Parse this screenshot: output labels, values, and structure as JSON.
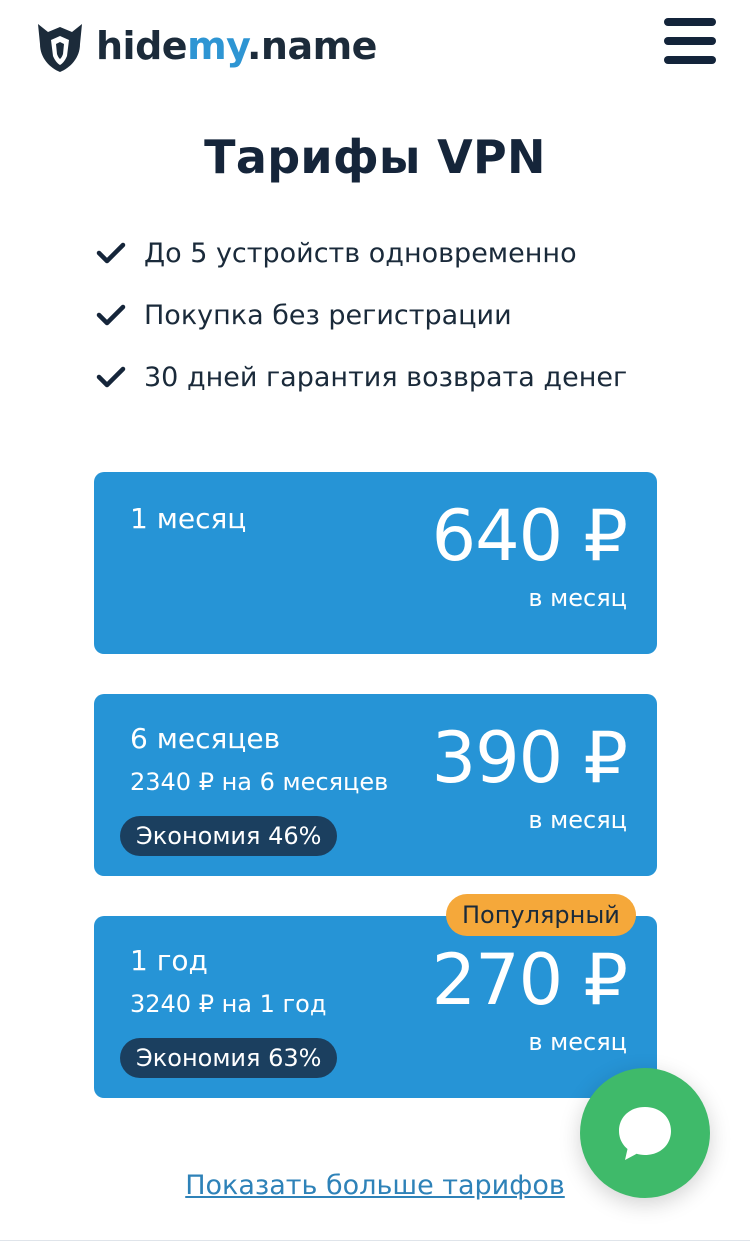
{
  "header": {
    "logo_part1": "hide",
    "logo_accent": "my",
    "logo_part2": ".name"
  },
  "page_title": "Тарифы VPN",
  "features": [
    "До 5 устройств одновременно",
    "Покупка без регистрации",
    "30 дней гарантия возврата денег"
  ],
  "plans": [
    {
      "name": "1 месяц",
      "price": "640 ₽",
      "per": "в месяц"
    },
    {
      "name": "6 месяцев",
      "total": "2340 ₽ на 6 месяцев",
      "savings": "Экономия 46%",
      "price": "390 ₽",
      "per": "в месяц"
    },
    {
      "name": "1 год",
      "total": "3240 ₽ на 1 год",
      "savings": "Экономия 63%",
      "price": "270 ₽",
      "per": "в месяц",
      "badge": "Популярный"
    }
  ],
  "more_link": "Показать больше тарифов",
  "colors": {
    "card": "#2694d6",
    "savings_pill": "#1b3f5f",
    "badge": "#f5a83a",
    "chat": "#3fba6a",
    "accent": "#2e95d3"
  },
  "icons": {
    "logo": "fox-shield-icon",
    "menu": "hamburger-menu-icon",
    "check": "checkmark-icon",
    "chat": "chat-bubble-icon"
  }
}
